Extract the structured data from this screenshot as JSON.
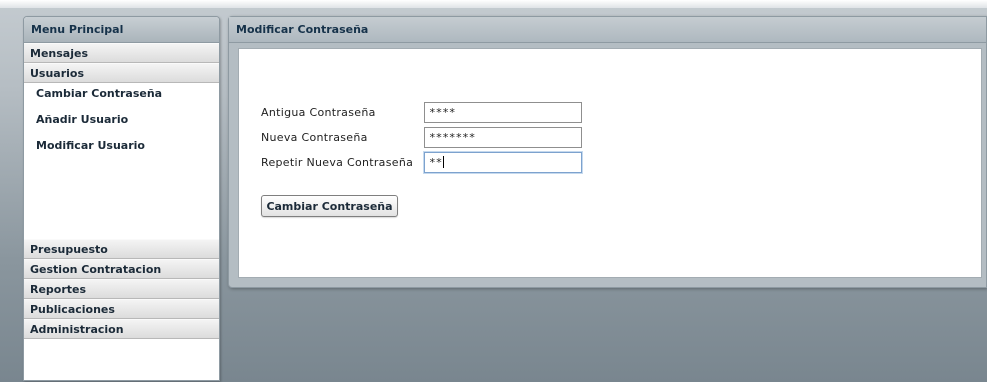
{
  "sidebar": {
    "title": "Menu Principal",
    "sections_top": [
      "Mensajes",
      "Usuarios"
    ],
    "links": [
      "Cambiar Contraseña",
      "Añadir Usuario",
      "Modificar Usuario"
    ],
    "sections_bottom": [
      "Presupuesto",
      "Gestion Contratacion",
      "Reportes",
      "Publicaciones",
      "Administracion"
    ]
  },
  "main": {
    "title": "Modificar Contraseña",
    "fields": [
      {
        "label": "Antigua Contraseña",
        "value": "****"
      },
      {
        "label": "Nueva Contraseña",
        "value": "*******"
      },
      {
        "label": "Repetir Nueva Contraseña",
        "value": "**"
      }
    ],
    "submit_label": "Cambiar Contraseña"
  },
  "colors": {
    "header_text": "#16324a",
    "focus_border": "#7da2ce",
    "background_top": "#c4cbd0",
    "background_bottom": "#79868f"
  }
}
